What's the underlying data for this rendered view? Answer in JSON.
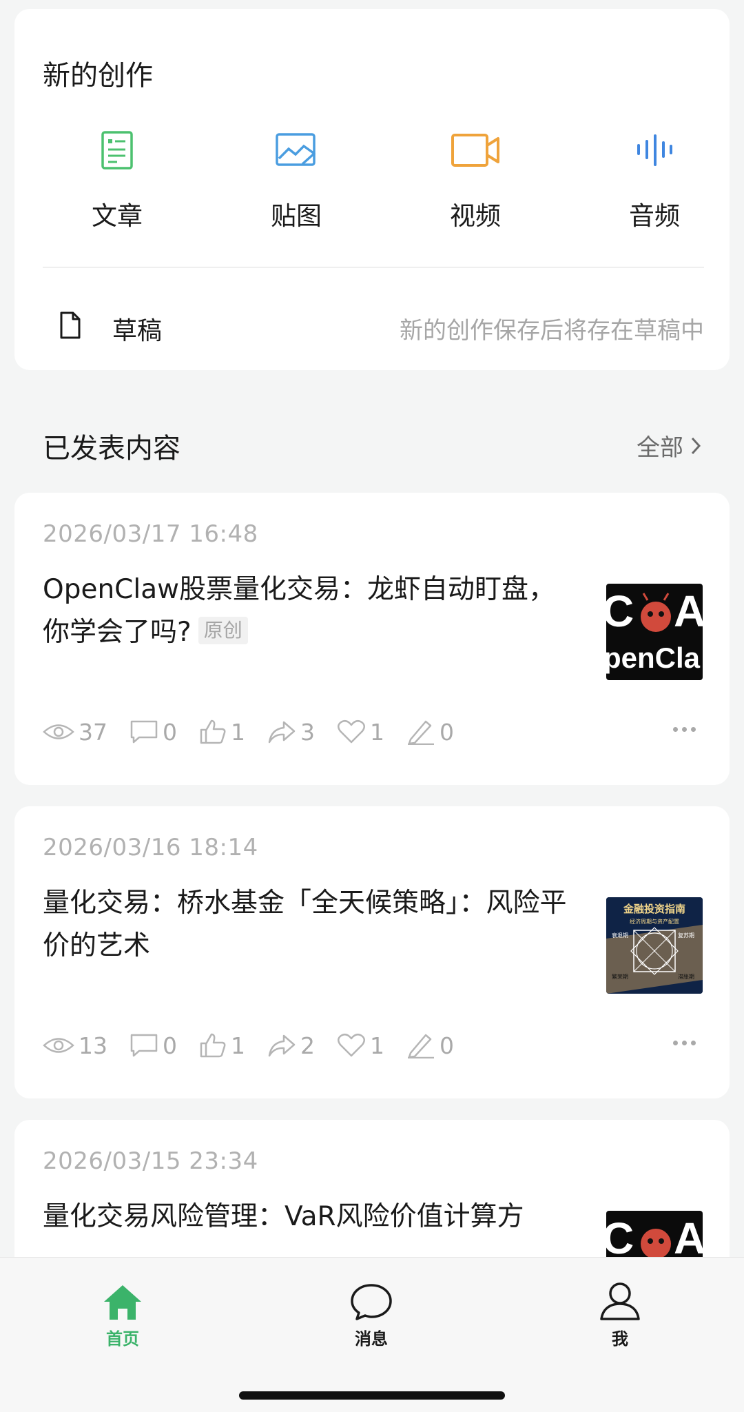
{
  "create": {
    "title": "新的创作",
    "items": [
      {
        "label": "文章",
        "icon": "article-icon",
        "color": "#4cc16f"
      },
      {
        "label": "贴图",
        "icon": "image-icon",
        "color": "#4a9de0"
      },
      {
        "label": "视频",
        "icon": "video-icon",
        "color": "#efa33b"
      },
      {
        "label": "音频",
        "icon": "audio-icon",
        "color": "#3f86e0"
      }
    ],
    "draft_label": "草稿",
    "draft_hint": "新的创作保存后将存在草稿中"
  },
  "published": {
    "title": "已发表内容",
    "see_all": "全部"
  },
  "posts": [
    {
      "date": "2026/03/17 16:48",
      "title": "OpenClaw股票量化交易：龙虾自动盯盘，你学会了吗?",
      "badge": "原创",
      "thumb_text": "penCla",
      "stats": {
        "views": "37",
        "comments": "0",
        "likes": "1",
        "shares": "3",
        "favorites": "1",
        "notes": "0"
      }
    },
    {
      "date": "2026/03/16 18:14",
      "title": "量化交易：桥水基金「全天候策略」：风险平价的艺术",
      "thumb_title": "金融投资指南",
      "thumb_subtitle": "经济周期与资产配置",
      "thumb_quadrants": [
        "衰退期",
        "复苏期",
        "繁荣期",
        "滞胀期"
      ],
      "stats": {
        "views": "13",
        "comments": "0",
        "likes": "1",
        "shares": "2",
        "favorites": "1",
        "notes": "0"
      }
    },
    {
      "date": "2026/03/15 23:34",
      "title": "量化交易风险管理：VaR风险价值计算方"
    }
  ],
  "tabbar": {
    "tabs": [
      {
        "label": "首页",
        "icon": "home-icon",
        "active": true
      },
      {
        "label": "消息",
        "icon": "message-icon",
        "active": false
      },
      {
        "label": "我",
        "icon": "user-icon",
        "active": false
      }
    ],
    "active_color": "#3bb36a"
  }
}
